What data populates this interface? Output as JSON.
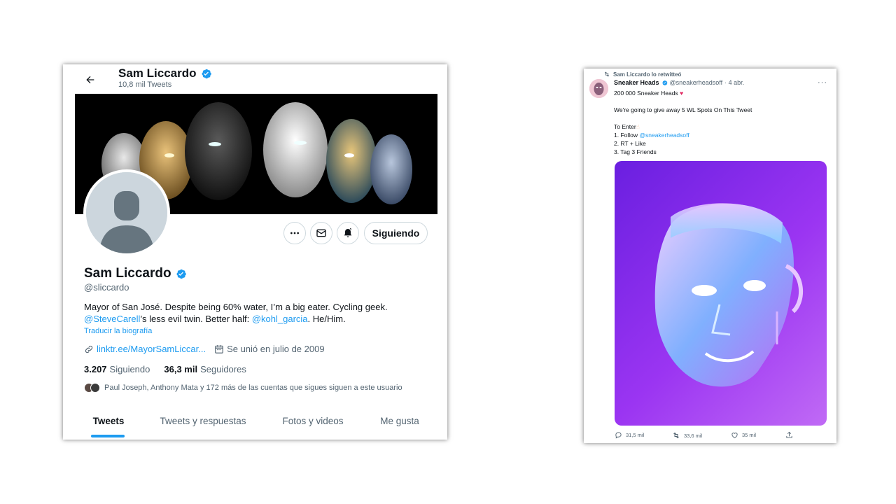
{
  "profile_header": {
    "name": "Sam Liccardo",
    "tweet_count": "10,8 mil Tweets"
  },
  "profile": {
    "name": "Sam Liccardo",
    "handle": "@sliccardo",
    "bio_line1": "Mayor of San José. Despite being 60% water, I’m a big eater. Cycling geek.",
    "bio_mention1": "@SteveCarell",
    "bio_line2_mid": "’s less evil twin. Better half: ",
    "bio_mention2": "@kohl_garcia",
    "bio_line2_end": ". He/Him.",
    "translate_label": "Traducir la biografía",
    "website": "linktr.ee/MayorSamLiccar...",
    "joined": "Se unió en julio de 2009",
    "following_count": "3.207",
    "following_label": "Siguiendo",
    "followers_count": "36,3 mil",
    "followers_label": "Seguidores",
    "known_followers": "Paul Joseph, Anthony Mata y 172 más de las cuentas que sigues siguen a este usuario",
    "follow_button": "Siguiendo"
  },
  "tabs": [
    {
      "label": "Tweets",
      "active": true
    },
    {
      "label": "Tweets y respuestas",
      "active": false
    },
    {
      "label": "Fotos y videos",
      "active": false
    },
    {
      "label": "Me gusta",
      "active": false
    }
  ],
  "tweet": {
    "retweet_label": "Sam Liccardo lo retwitteó",
    "author_name": "Sneaker Heads",
    "author_handle": "@sneakerheadsoff",
    "date": "· 4 abr.",
    "line1": "200 000 Sneaker Heads",
    "line3": "We're going to give away 5 WL Spots On This Tweet",
    "line5": "To Enter",
    "line6_prefix": "1. Follow ",
    "line6_mention": "@sneakerheadsoff",
    "line7": "2. RT + Like",
    "line8": "3. Tag 3 Friends",
    "replies": "31,5 mil",
    "retweets": "33,6 mil",
    "likes": "35 mil",
    "more_label": "···"
  },
  "colors": {
    "accent": "#1d9bf0",
    "verified": "#1d9bf0",
    "heart": "#e0245e"
  },
  "icons": [
    "back-arrow-icon",
    "verified-icon",
    "more-icon",
    "mail-icon",
    "bell-icon",
    "link-icon",
    "calendar-icon",
    "retweet-icon",
    "reply-icon",
    "like-icon",
    "share-icon"
  ]
}
